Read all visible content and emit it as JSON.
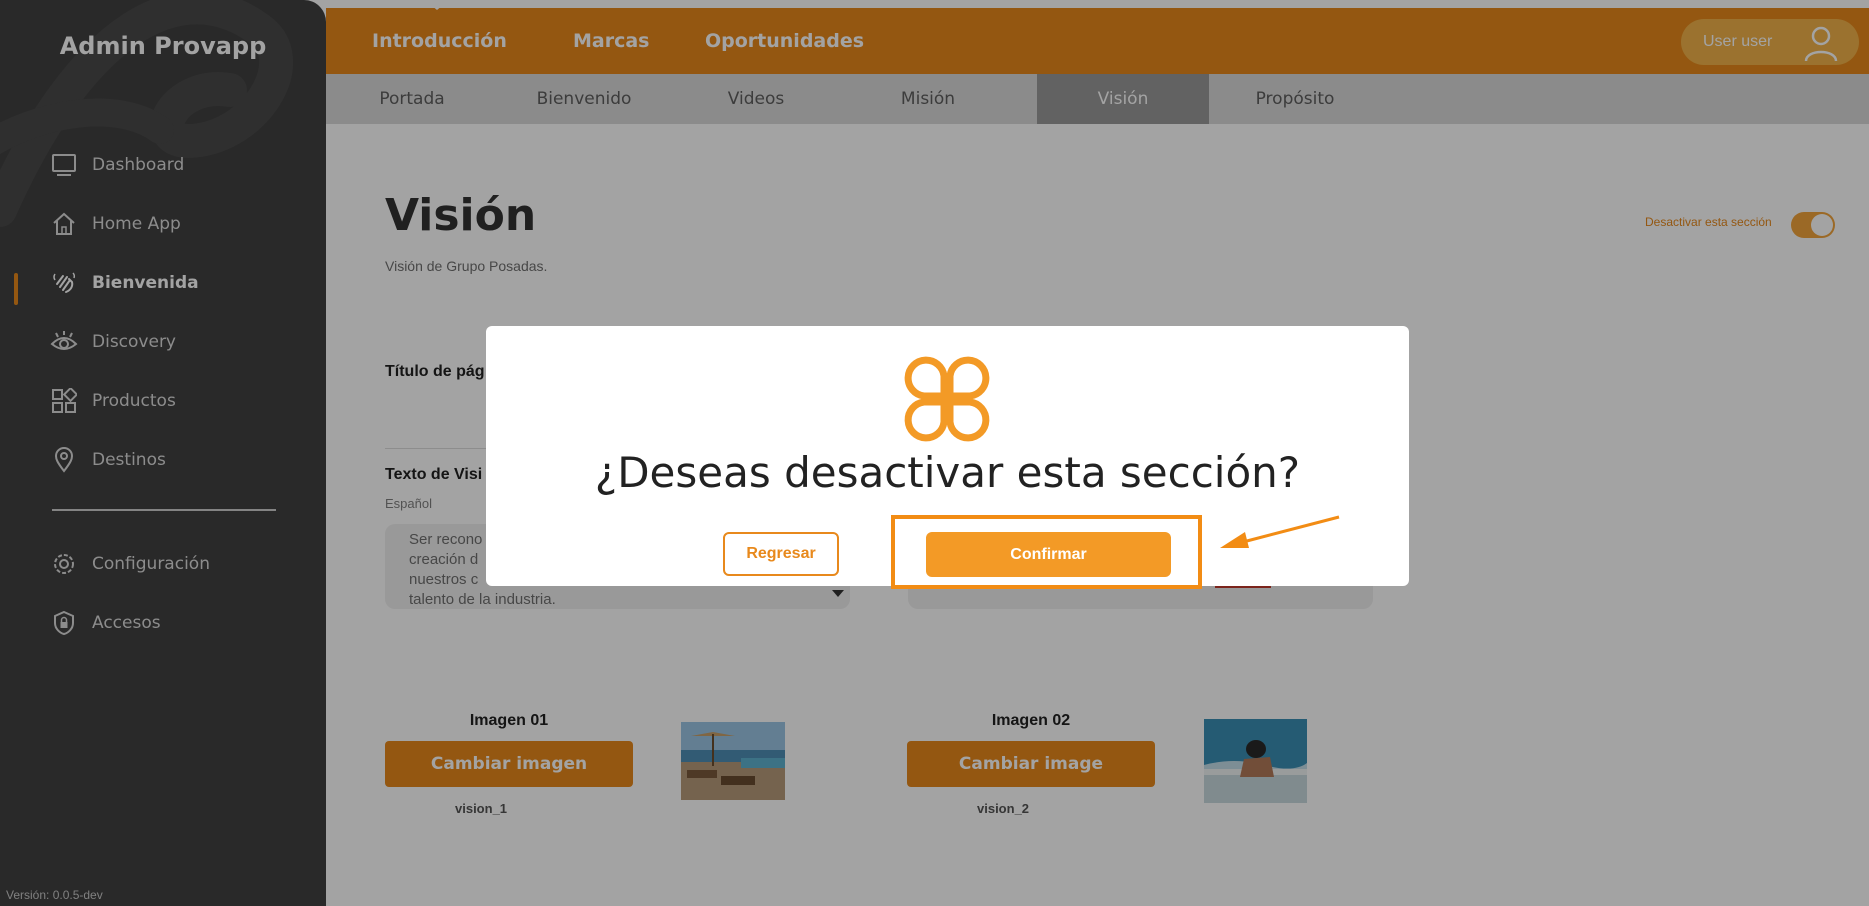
{
  "sidebar": {
    "brand": "Admin Provapp",
    "items": [
      {
        "label": "Dashboard",
        "icon": "monitor-icon"
      },
      {
        "label": "Home App",
        "icon": "home-icon"
      },
      {
        "label": "Bienvenida",
        "icon": "waving-hand-icon"
      },
      {
        "label": "Discovery",
        "icon": "eye-icon"
      },
      {
        "label": "Productos",
        "icon": "grid-shapes-icon"
      },
      {
        "label": "Destinos",
        "icon": "location-pin-icon"
      },
      {
        "label": "Configuración",
        "icon": "gear-icon"
      },
      {
        "label": "Accesos",
        "icon": "shield-lock-icon"
      }
    ],
    "active_item": "Bienvenida",
    "version": "Versión: 0.0.5-dev"
  },
  "topbar": {
    "tabs": [
      "Introducción",
      "Marcas",
      "Oportunidades"
    ],
    "user_label": "User user"
  },
  "subtabs": {
    "items": [
      "Portada",
      "Bienvenido",
      "Videos",
      "Misión",
      "Visión",
      "Propósito"
    ],
    "active": "Visión"
  },
  "page": {
    "title": "Visión",
    "subtitle": "Visión de Grupo Posadas.",
    "toggle_label": "Desactivar esta sección",
    "page_title_label": "Título de pág",
    "text_label": "Texto de Visi",
    "language_label": "Español",
    "text_lines": [
      "Ser recono",
      "creación d",
      "nuestros c",
      "talento de la industria."
    ],
    "images": [
      {
        "title": "Imagen 01",
        "button": "Cambiar imagen",
        "name": "vision_1"
      },
      {
        "title": "Imagen 02",
        "button": "Cambiar image",
        "name": "vision_2"
      }
    ]
  },
  "modal": {
    "question": "¿Deseas desactivar esta sección?",
    "back_label": "Regresar",
    "confirm_label": "Confirmar"
  },
  "colors": {
    "accent": "#e8891c",
    "sidebar_bg": "#404040",
    "annotation": "#f28c14"
  }
}
